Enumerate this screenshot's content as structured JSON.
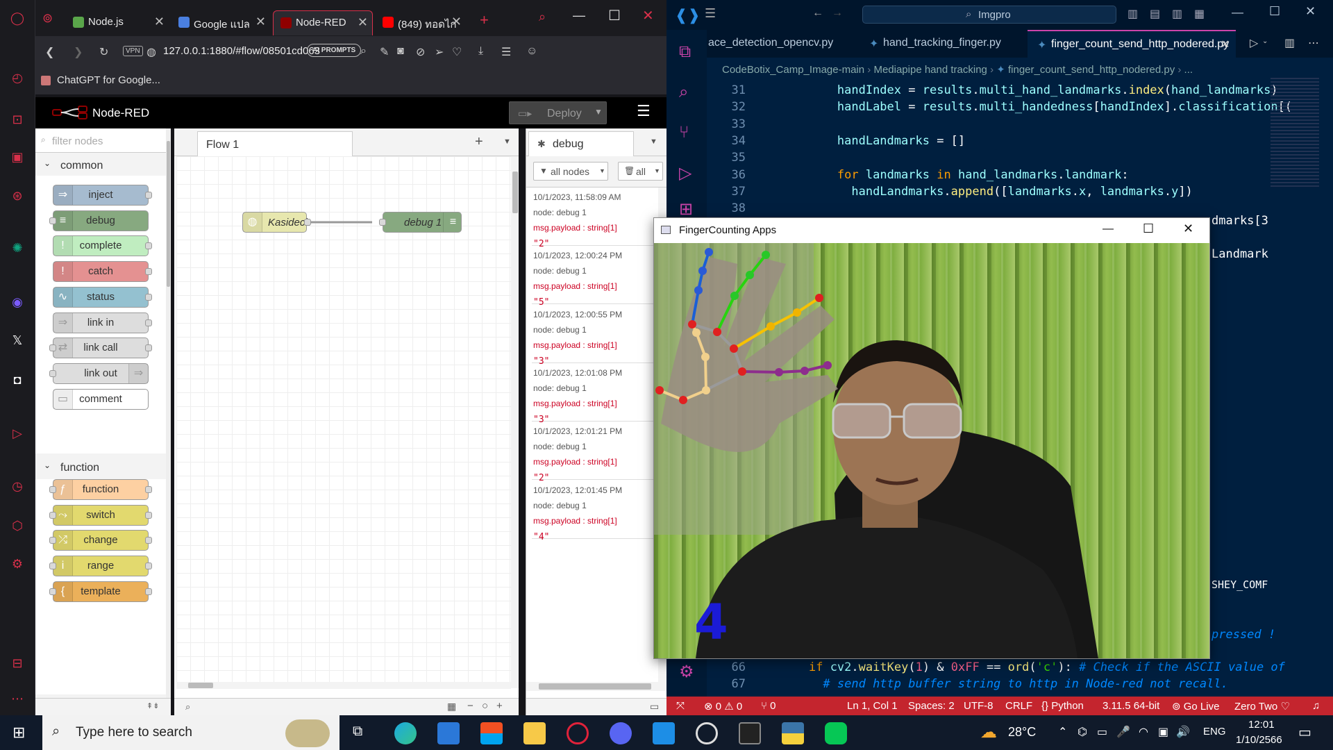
{
  "browser": {
    "tabs": [
      {
        "label": "Node.js",
        "fav": "#5aa64a"
      },
      {
        "label": "Google แปล",
        "fav": "#4a7fe0"
      },
      {
        "label": "Node-RED",
        "fav": "#8f0000",
        "active": true
      },
      {
        "label": "(849) ทอดไก่",
        "fav": "#ff0000"
      }
    ],
    "vpn_label": "VPN",
    "url": "127.0.0.1:1880/#flow/08501cd063",
    "ai_prompts": "AI PROMPTS",
    "bookmark": "ChatGPT for Google..."
  },
  "nodered": {
    "title": "Node-RED",
    "deploy": "Deploy",
    "filter_placeholder": "filter nodes",
    "flow_tab": "Flow 1",
    "categories": {
      "common": "common",
      "function": "function"
    },
    "palette_common": [
      {
        "label": "inject",
        "color": "#a6bbcf",
        "icon": "inject-icon",
        "glyph": "⇒"
      },
      {
        "label": "debug",
        "color": "#87a980",
        "icon": "debug-icon",
        "glyph": "≡"
      },
      {
        "label": "complete",
        "color": "#c0edc0",
        "icon": "complete-icon",
        "glyph": "!"
      },
      {
        "label": "catch",
        "color": "#e49191",
        "icon": "catch-icon",
        "glyph": "!"
      },
      {
        "label": "status",
        "color": "#94c1d0",
        "icon": "status-icon",
        "glyph": "∿"
      },
      {
        "label": "link in",
        "color": "#dddddd",
        "icon": "link-in-icon",
        "glyph": "⇒"
      },
      {
        "label": "link call",
        "color": "#dddddd",
        "icon": "link-call-icon",
        "glyph": "⇄"
      },
      {
        "label": "link out",
        "color": "#dddddd",
        "icon": "link-out-icon",
        "glyph": "⇒"
      },
      {
        "label": "comment",
        "color": "#ffffff",
        "icon": "comment-icon",
        "glyph": "▭"
      }
    ],
    "palette_function": [
      {
        "label": "function",
        "color": "#fdd0a2",
        "icon": "function-icon",
        "glyph": "ƒ"
      },
      {
        "label": "switch",
        "color": "#e2d96e",
        "icon": "switch-icon",
        "glyph": "⤳"
      },
      {
        "label": "change",
        "color": "#e2d96e",
        "icon": "change-icon",
        "glyph": "⤮"
      },
      {
        "label": "range",
        "color": "#e2d96e",
        "icon": "range-icon",
        "glyph": "i"
      },
      {
        "label": "template",
        "color": "#ebb05a",
        "icon": "template-icon",
        "glyph": "{"
      }
    ],
    "flow_nodes": {
      "source": "Kasidech",
      "target": "debug 1"
    },
    "debug": {
      "tab": "debug",
      "filter": "all nodes",
      "clear": "all",
      "messages": [
        {
          "time": "10/1/2023, 11:58:09 AM",
          "node": "node: debug 1",
          "payload": "msg.payload : string[1]",
          "value": "\"2\""
        },
        {
          "time": "10/1/2023, 12:00:24 PM",
          "node": "node: debug 1",
          "payload": "msg.payload : string[1]",
          "value": "\"5\""
        },
        {
          "time": "10/1/2023, 12:00:55 PM",
          "node": "node: debug 1",
          "payload": "msg.payload : string[1]",
          "value": "\"3\""
        },
        {
          "time": "10/1/2023, 12:01:08 PM",
          "node": "node: debug 1",
          "payload": "msg.payload : string[1]",
          "value": "\"3\""
        },
        {
          "time": "10/1/2023, 12:01:21 PM",
          "node": "node: debug 1",
          "payload": "msg.payload : string[1]",
          "value": "\"2\""
        },
        {
          "time": "10/1/2023, 12:01:45 PM",
          "node": "node: debug 1",
          "payload": "msg.payload : string[1]",
          "value": "\"4\""
        }
      ]
    }
  },
  "vscode": {
    "search": "Imgpro",
    "tabs": [
      "ace_detection_opencv.py",
      "hand_tracking_finger.py",
      "finger_count_send_http_nodered.py"
    ],
    "breadcrumb": [
      "CodeBotix_Camp_Image-main",
      "Mediapipe hand tracking",
      "finger_count_send_http_nodered.py",
      "..."
    ],
    "lines": [
      {
        "n": "31",
        "html": "        <span class='id'>handIndex</span> = <span class='id'>results</span>.<span class='id'>multi_hand_landmarks</span>.<span class='fn'>index</span>(<span class='id'>hand_landmarks</span>)"
      },
      {
        "n": "32",
        "html": "        <span class='id'>handLabel</span> = <span class='id'>results</span>.<span class='id'>multi_handedness</span>[<span class='id'>handIndex</span>].<span class='id'>classification</span>[("
      },
      {
        "n": "33",
        "html": ""
      },
      {
        "n": "34",
        "html": "        <span class='id'>handLandmarks</span> = []"
      },
      {
        "n": "35",
        "html": ""
      },
      {
        "n": "36",
        "html": "        <span class='kw'>for</span> <span class='id'>landmarks</span> <span class='kw'>in</span> <span class='id'>hand_landmarks</span>.<span class='id'>landmark</span>:"
      },
      {
        "n": "37",
        "html": "          <span class='id'>handLandmarks</span>.<span class='fn'>append</span>([<span class='id'>landmarks</span>.<span class='id'>x</span>, <span class='id'>landmarks</span>.<span class='id'>y</span>])"
      },
      {
        "n": "38",
        "html": ""
      }
    ],
    "lines_bottom": [
      {
        "n": "66",
        "html": "    <span class='kw'>if</span> <span class='id'>cv2</span>.<span class='fn'>waitKey</span>(<span class='num'>1</span>) &amp; <span class='num'>0xFF</span> == <span class='fn'>ord</span>(<span class='str'>'c'</span>): <span class='cm'># Check if the ASCII value of</span>"
      },
      {
        "n": "67",
        "html": "      <span class='cm'># send http buffer string to http in Node-red not recall.</span>"
      }
    ],
    "right_fragments": [
      "dmarks[3",
      "Landmark",
      "SHEY_COMF",
      "pressed !"
    ],
    "status": {
      "errors": "0",
      "warnings": "0",
      "ports": "0",
      "position": "Ln 1, Col 1",
      "spaces": "Spaces: 2",
      "encoding": "UTF-8",
      "eol": "CRLF",
      "language": "Python",
      "interpreter": "3.11.5 64-bit",
      "golive": "Go Live",
      "theme": "Zero Two"
    }
  },
  "fingerapp": {
    "title": "FingerCounting Apps",
    "count": "4"
  },
  "taskbar": {
    "search_placeholder": "Type here to search",
    "temperature": "28°C",
    "lang": "ENG",
    "time": "12:01",
    "date": "1/10/2566"
  }
}
